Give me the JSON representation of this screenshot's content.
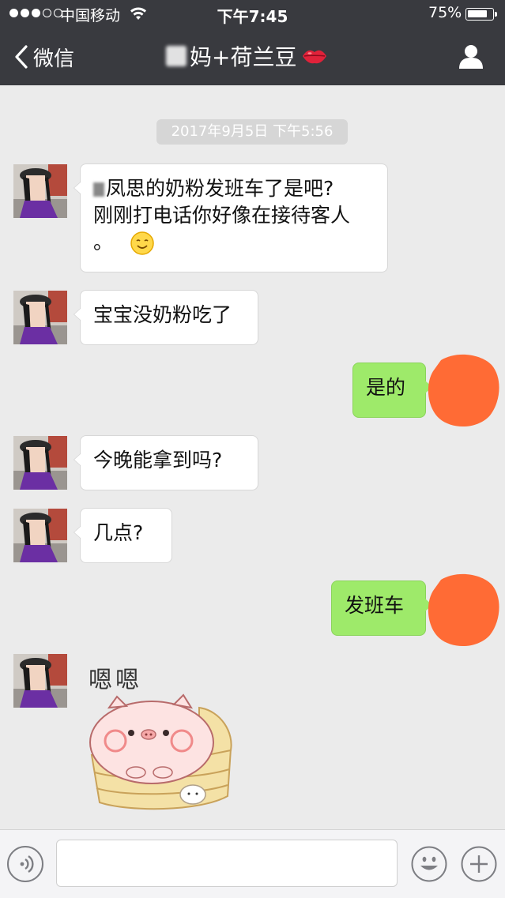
{
  "status_bar": {
    "carrier": "中国移动",
    "time": "下午7:45",
    "battery": "75%",
    "battery_level": 0.75
  },
  "nav": {
    "back_label": "微信",
    "title": "妈+荷兰豆"
  },
  "timestamp": "2017年9月5日 下午5:56",
  "messages": [
    {
      "from": "them",
      "lines": [
        "凤思的奶粉发班车了是吧?",
        "刚刚打电话你好像在接待客人",
        "。"
      ]
    },
    {
      "from": "them",
      "text": "宝宝没奶粉吃了"
    },
    {
      "from": "me",
      "text": "是的"
    },
    {
      "from": "them",
      "text": "今晚能拿到吗?"
    },
    {
      "from": "them",
      "text": "几点?"
    },
    {
      "from": "me",
      "text": "发班车"
    },
    {
      "from": "them",
      "sticker_text": "嗯嗯",
      "sticker": "pig-in-steamer-sticker"
    }
  ],
  "colors": {
    "nav_bg": "#393a3f",
    "chat_bg": "#ebebeb",
    "my_bubble": "#9eea6a",
    "their_bubble": "#ffffff",
    "my_avatar_scribble": "#ff6b35"
  }
}
